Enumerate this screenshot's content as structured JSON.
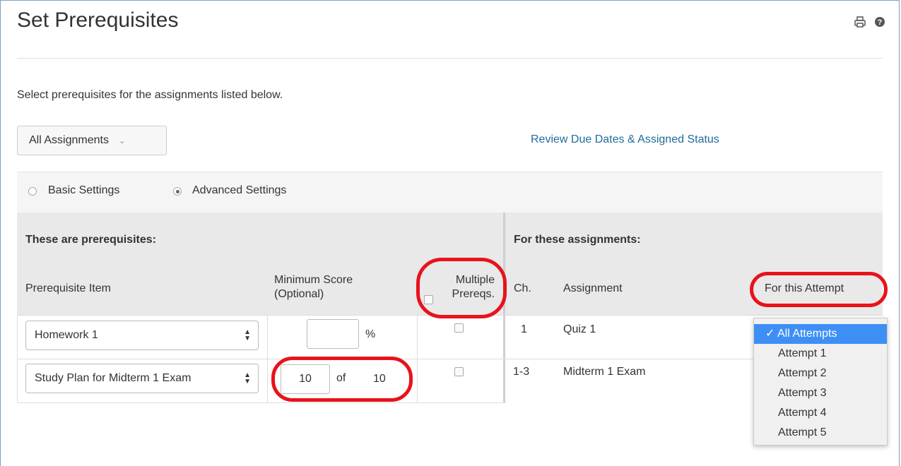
{
  "page": {
    "title": "Set Prerequisites",
    "intro": "Select prerequisites for the assignments listed below."
  },
  "toolbar": {
    "assignment_filter": "All Assignments",
    "review_link": "Review Due Dates & Assigned Status"
  },
  "settings": {
    "basic_label": "Basic Settings",
    "advanced_label": "Advanced Settings",
    "selected": "Advanced Settings"
  },
  "left_section": {
    "heading": "These are prerequisites:",
    "col_item": "Prerequisite Item",
    "col_min_score_1": "Minimum Score",
    "col_min_score_2": "(Optional)",
    "col_multiple_1": "Multiple",
    "col_multiple_2": "Prereqs."
  },
  "right_section": {
    "heading": "For these assignments:",
    "col_ch": "Ch.",
    "col_assignment": "Assignment",
    "col_attempt": "For this Attempt"
  },
  "rows": [
    {
      "prereq_item": "Homework 1",
      "min_score_value": "",
      "min_score_unit": "%",
      "multiple_checked": false,
      "ch": "1",
      "assignment": "Quiz 1"
    },
    {
      "prereq_item": "Study Plan for Midterm 1 Exam",
      "min_score_value": "10",
      "min_score_of": "of",
      "min_score_total": "10",
      "multiple_checked": false,
      "ch": "1-3",
      "assignment": "Midterm 1 Exam"
    }
  ],
  "attempt_dropdown": {
    "selected": "All Attempts",
    "options": [
      "All Attempts",
      "Attempt 1",
      "Attempt 2",
      "Attempt 3",
      "Attempt 4",
      "Attempt 5"
    ]
  },
  "colors": {
    "link": "#1f6b9a",
    "highlight_ring": "#e8131a",
    "dropdown_selected": "#3d8ff5",
    "header_bg": "#e9e9e9"
  }
}
